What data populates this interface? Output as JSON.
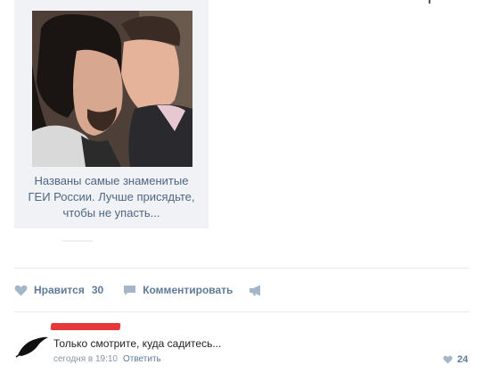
{
  "post": {
    "headline_lines": [
      "Названы самые знаменитые",
      "ГЕИ России. Лучше присядьте,",
      "чтобы не упасть..."
    ],
    "link_color": "#4f6683"
  },
  "actions": {
    "like_label": "Нравится",
    "like_count": "30",
    "comment_label": "Комментировать",
    "like_icon": "heart-icon",
    "comment_icon": "speech-bubble-icon",
    "share_icon": "megaphone-icon",
    "action_color": "#5f7a99"
  },
  "comment": {
    "text": "Только смотрите, куда садитесь...",
    "time": "сегодня в 19:10",
    "reply_label": "Ответить",
    "like_count": "24",
    "redaction_color": "#e5383b"
  }
}
